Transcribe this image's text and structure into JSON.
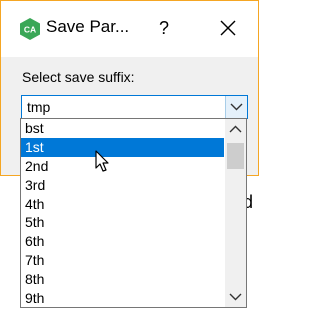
{
  "dialog": {
    "title": "Save Par...",
    "help_label": "?",
    "app_icon_text": "CA",
    "prompt": "Select save suffix:",
    "combo": {
      "value": "tmp"
    },
    "dropdown": {
      "items": [
        "bst",
        "1st",
        "2nd",
        "3rd",
        "4th",
        "5th",
        "6th",
        "7th",
        "8th",
        "9th"
      ],
      "selected": "1st"
    }
  },
  "background": {
    "fragment_left": "t",
    "fragment_right": "uld"
  },
  "colors": {
    "accent": "#0078d7",
    "frame": "#f5a623",
    "app_icon": "#3aa757"
  }
}
